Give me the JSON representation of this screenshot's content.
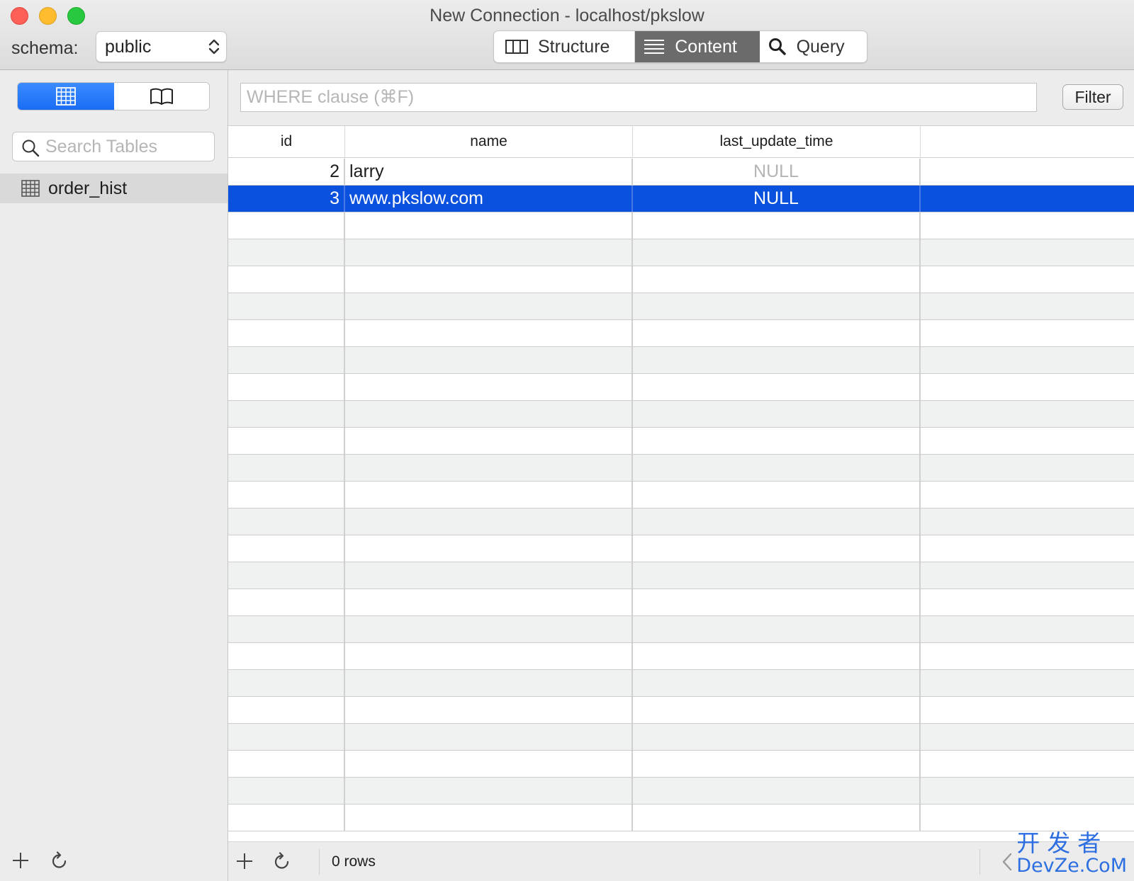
{
  "window": {
    "title": "New Connection - localhost/pkslow"
  },
  "toolbar": {
    "schema_label": "schema:",
    "schema_value": "public",
    "tabs": [
      {
        "label": "Structure",
        "icon": "columns-icon",
        "active": false
      },
      {
        "label": "Content",
        "icon": "list-icon",
        "active": true
      },
      {
        "label": "Query",
        "icon": "search-icon",
        "active": false
      }
    ]
  },
  "sidebar": {
    "view_toggle": [
      {
        "icon": "table-grid-icon",
        "active": true
      },
      {
        "icon": "book-icon",
        "active": false
      }
    ],
    "search": {
      "placeholder": "Search Tables",
      "value": ""
    },
    "tables": [
      {
        "name": "order_hist",
        "icon": "table-icon",
        "selected": true
      }
    ]
  },
  "content": {
    "where_placeholder": "WHERE clause (⌘F)",
    "filter_label": "Filter",
    "columns": [
      "id",
      "name",
      "last_update_time",
      ""
    ],
    "rows": [
      {
        "id": "2",
        "name": "larry",
        "last_update_time": "NULL",
        "selected": false
      },
      {
        "id": "3",
        "name": "www.pkslow.com",
        "last_update_time": "NULL",
        "selected": true
      }
    ],
    "empty_row_count": 23,
    "footer": {
      "rows_text": "0 rows"
    }
  },
  "watermark": {
    "line1": "开发者",
    "line2": "DevZe.CoM"
  },
  "colors": {
    "selection": "#0a52de",
    "accent": "#1a6cf5",
    "close": "#fe5f57",
    "minimize": "#febc2e",
    "maximize": "#28c840"
  }
}
